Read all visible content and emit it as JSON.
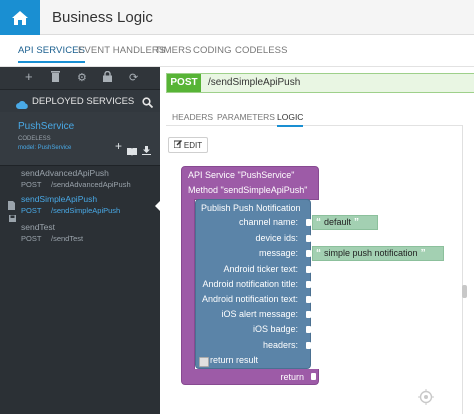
{
  "header": {
    "title": "Business Logic",
    "home_icon": "home-icon"
  },
  "tabs": [
    {
      "label": "API SERVICES",
      "active": true
    },
    {
      "label": "EVENT HANDLERS"
    },
    {
      "label": "TIMERS"
    },
    {
      "label": "CODING"
    },
    {
      "label": "CODELESS"
    }
  ],
  "sidebar": {
    "deployed_label": "DEPLOYED SERVICES",
    "service": {
      "name": "PushService",
      "type": "CODELESS",
      "model": "model: PushService"
    },
    "methods": [
      {
        "name": "sendAdvancedApiPush",
        "verb": "POST",
        "path": "/sendAdvancedApiPush"
      },
      {
        "name": "sendSimpleApiPush",
        "verb": "POST",
        "path": "/sendSimpleApiPush",
        "active": true
      },
      {
        "name": "sendTest",
        "verb": "POST",
        "path": "/sendTest"
      }
    ]
  },
  "main": {
    "route": {
      "verb": "POST",
      "path": "/sendSimpleApiPush"
    },
    "subtabs": [
      "HEADERS",
      "PARAMETERS",
      "LOGIC"
    ],
    "active_subtab": "LOGIC",
    "edit_label": "EDIT",
    "block": {
      "service_line": "API Service \"PushService\"",
      "method_line": "Method \"sendSimpleApiPush\"",
      "inner_title": "Publish Push Notification",
      "inputs": [
        "channel name:",
        "device ids:",
        "message:",
        "Android ticker text:",
        "Android notification title:",
        "Android notification text:",
        "iOS alert message:",
        "iOS badge:",
        "headers:"
      ],
      "channel_value": "default",
      "message_value": "simple push notification",
      "quote_open": "“",
      "quote_close": "”",
      "return_result": "return result",
      "return_label": "return"
    }
  },
  "colors": {
    "accent": "#1a8fd2",
    "sidebar_bg": "#2b3035",
    "post_green": "#57b436",
    "block_purple": "#9d5ba7",
    "block_blue": "#5b84a8",
    "string_green": "#a3d0b2"
  }
}
